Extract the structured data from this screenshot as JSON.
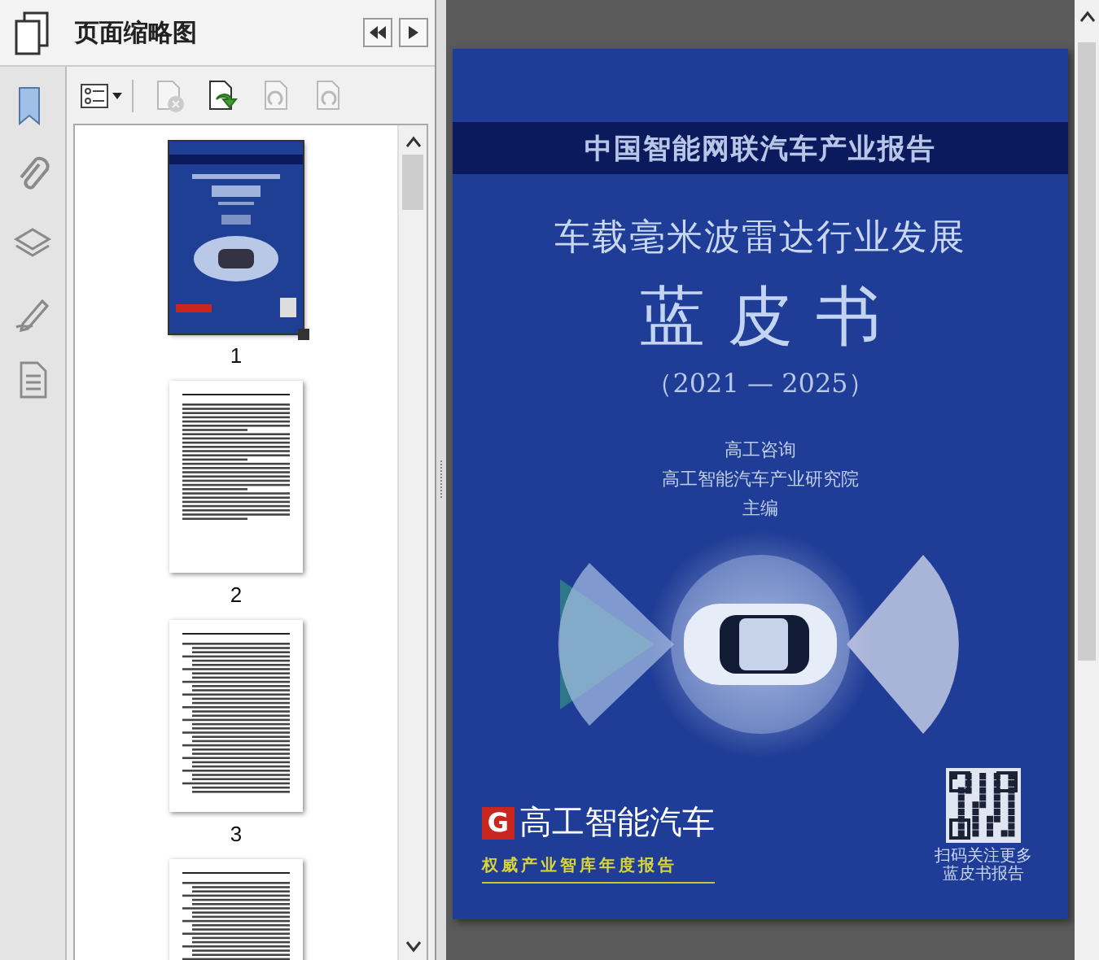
{
  "panel": {
    "title": "页面缩略图"
  },
  "rail": [
    {
      "kind": "bookmark",
      "selected": true
    },
    {
      "kind": "attachment",
      "selected": false
    },
    {
      "kind": "layers",
      "selected": false
    },
    {
      "kind": "signature",
      "selected": false
    },
    {
      "kind": "document",
      "selected": false
    }
  ],
  "toolbar": [
    {
      "kind": "options",
      "disabled": false
    },
    {
      "kind": "delete",
      "disabled": true
    },
    {
      "kind": "insert",
      "disabled": false
    },
    {
      "kind": "rotate-left",
      "disabled": true
    },
    {
      "kind": "rotate-right",
      "disabled": true
    }
  ],
  "thumbnails": [
    {
      "label": "1",
      "kind": "cover",
      "selected": true
    },
    {
      "label": "2",
      "kind": "text",
      "selected": false
    },
    {
      "label": "3",
      "kind": "toc",
      "selected": false
    },
    {
      "kind": "toc",
      "selected": false
    }
  ],
  "cover": {
    "series": "中国智能网联汽车产业报告",
    "title": "车载毫米波雷达行业发展",
    "subtitle": "蓝皮书",
    "years": "（2021 — 2025）",
    "editors": [
      "高工咨询",
      "高工智能汽车产业研究院",
      "主编"
    ],
    "logo_mark": "G",
    "logo_text": "高工智能汽车",
    "tagline": "权威产业智库年度报告",
    "qr_caption": [
      "扫码关注更多",
      "蓝皮书报告"
    ]
  }
}
